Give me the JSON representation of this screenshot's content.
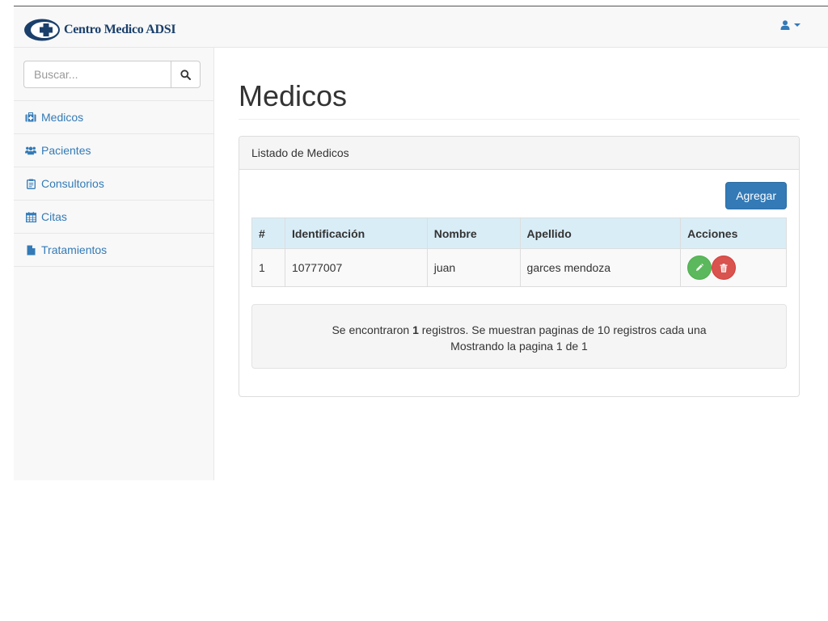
{
  "brand": {
    "name": "Centro Medico ADSI",
    "logo_icon": "medical-cross-logo",
    "color": "#1a3f6b"
  },
  "navbar": {
    "user_icon": "user-icon"
  },
  "sidebar": {
    "search": {
      "placeholder": "Buscar...",
      "icon": "search-icon"
    },
    "items": [
      {
        "label": "Medicos",
        "icon": "medkit-icon"
      },
      {
        "label": "Pacientes",
        "icon": "users-icon"
      },
      {
        "label": "Consultorios",
        "icon": "clipboard-icon"
      },
      {
        "label": "Citas",
        "icon": "calendar-icon"
      },
      {
        "label": "Tratamientos",
        "icon": "file-icon"
      }
    ]
  },
  "main": {
    "title": "Medicos",
    "panel": {
      "heading": "Listado de Medicos",
      "add_label": "Agregar",
      "table": {
        "headers": [
          "#",
          "Identificación",
          "Nombre",
          "Apellido",
          "Acciones"
        ],
        "rows": [
          {
            "num": "1",
            "identificacion": "10777007",
            "nombre": "juan",
            "apellido": "garces mendoza"
          }
        ]
      },
      "summary": {
        "prefix": "Se encontraron ",
        "count": "1",
        "suffix": " registros. Se muestran paginas de 10 registros cada una",
        "page_line": "Mostrando la pagina 1 de 1"
      }
    }
  },
  "colors": {
    "primary": "#337ab7",
    "success": "#5cb85c",
    "danger": "#d9534f",
    "table_header": "#d9edf7"
  }
}
